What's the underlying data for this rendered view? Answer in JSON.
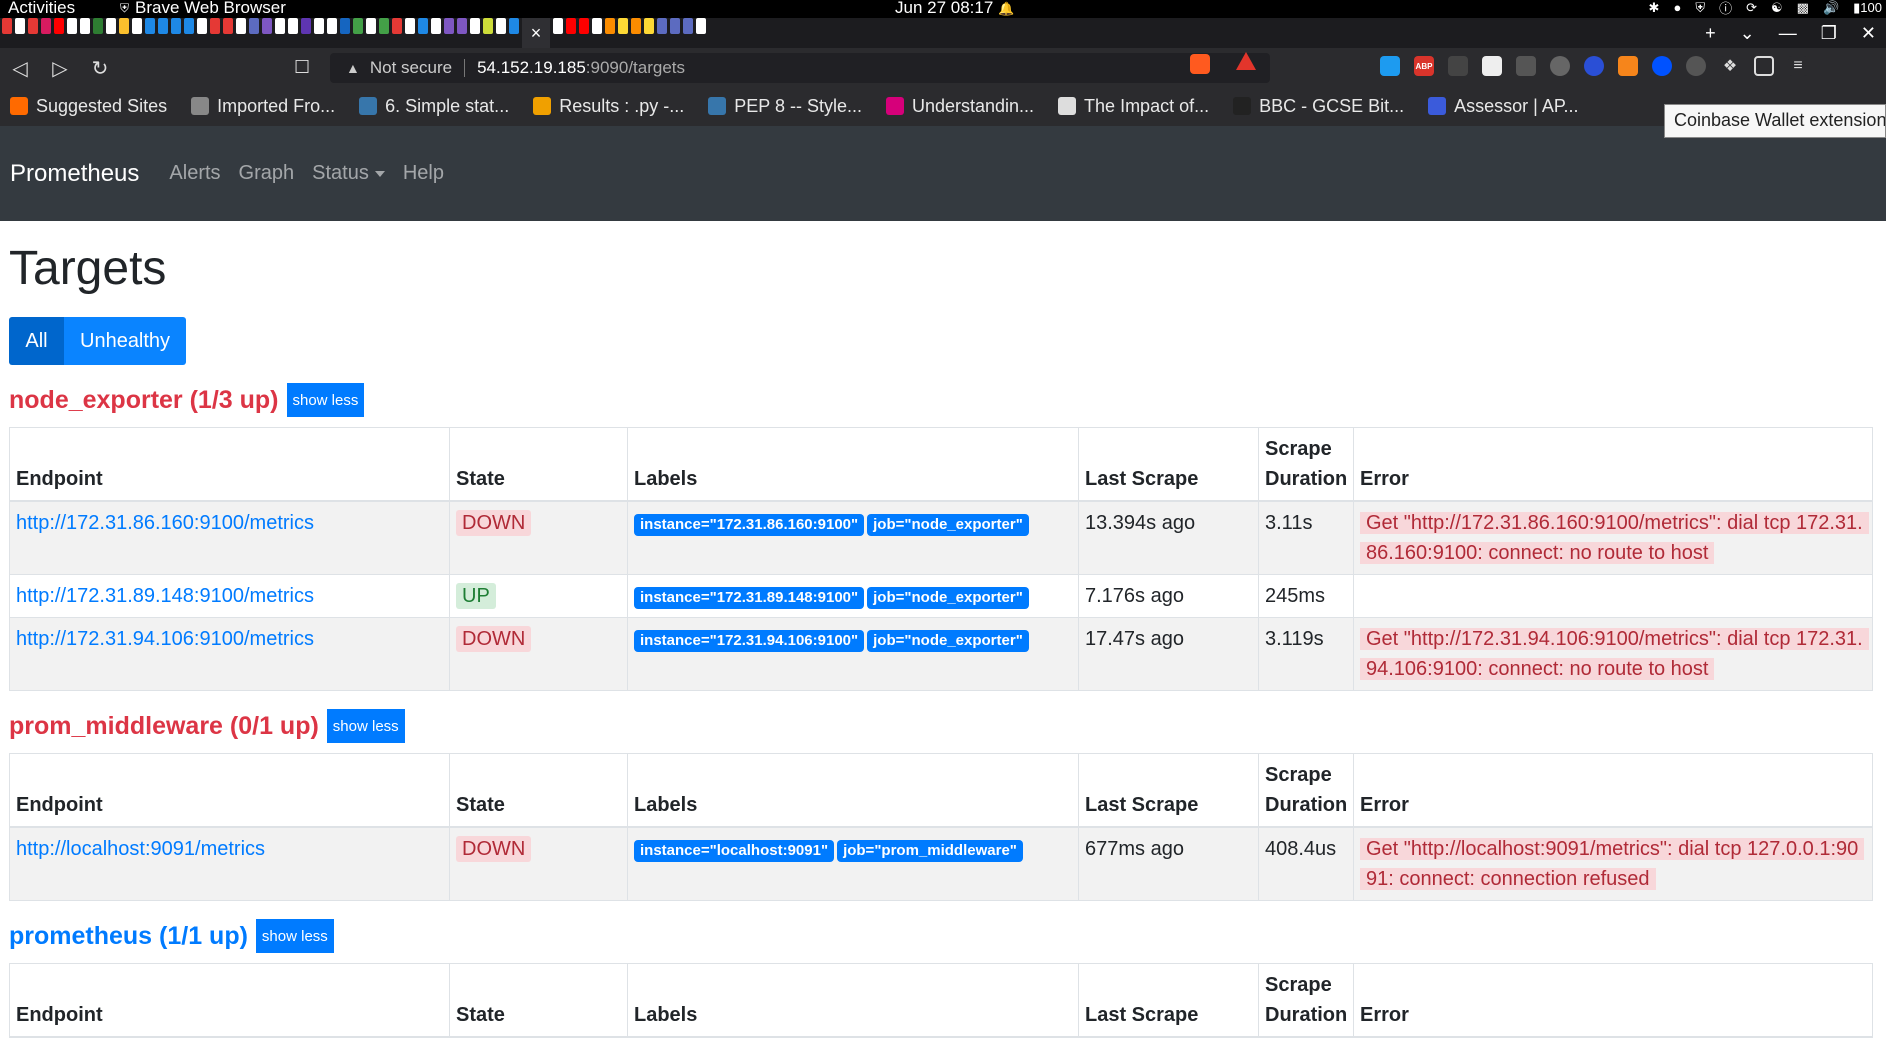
{
  "system": {
    "activities": "Activities",
    "app_name": "Brave Web Browser",
    "clock": "Jun 27  08:17",
    "battery": "100"
  },
  "browser": {
    "url_warning": "Not secure",
    "url_host": "54.152.19.185",
    "url_path": ":9090/targets",
    "bookmarks": [
      {
        "label": "Suggested Sites",
        "color": "#ff6a00"
      },
      {
        "label": "Imported Fro...",
        "color": "#888888"
      },
      {
        "label": "6. Simple stat...",
        "color": "#3776ab"
      },
      {
        "label": "Results : .py -...",
        "color": "#f0a000"
      },
      {
        "label": "PEP 8 -- Style...",
        "color": "#3776ab"
      },
      {
        "label": "Understandin...",
        "color": "#d6007a"
      },
      {
        "label": "The Impact of...",
        "color": "#dddddd"
      },
      {
        "label": "BBC - GCSE Bit...",
        "color": "#222222"
      },
      {
        "label": "Assessor | AP...",
        "color": "#3b5bdb"
      }
    ],
    "tooltip": "Coinbase Wallet extension"
  },
  "prom_nav": {
    "brand": "Prometheus",
    "alerts": "Alerts",
    "graph": "Graph",
    "status": "Status",
    "help": "Help"
  },
  "page": {
    "title": "Targets",
    "filter_all": "All",
    "filter_unhealthy": "Unhealthy"
  },
  "table_headers": {
    "endpoint": "Endpoint",
    "state": "State",
    "labels": "Labels",
    "last_scrape": "Last Scrape",
    "scrape_duration": "Scrape Duration",
    "error": "Error"
  },
  "groups": [
    {
      "title": "node_exporter (1/3 up)",
      "show_less": "show less",
      "rows": [
        {
          "endpoint": "http://172.31.86.160:9100/metrics",
          "state": "DOWN",
          "instance": "instance=\"172.31.86.160:9100\"",
          "job": "job=\"node_exporter\"",
          "last_scrape": "13.394s ago",
          "duration": "3.11s",
          "error": "Get \"http://172.31.86.160:9100/metrics\": dial tcp 172.31.86.160:9100: connect: no route to host"
        },
        {
          "endpoint": "http://172.31.89.148:9100/metrics",
          "state": "UP",
          "instance": "instance=\"172.31.89.148:9100\"",
          "job": "job=\"node_exporter\"",
          "last_scrape": "7.176s ago",
          "duration": "245ms",
          "error": ""
        },
        {
          "endpoint": "http://172.31.94.106:9100/metrics",
          "state": "DOWN",
          "instance": "instance=\"172.31.94.106:9100\"",
          "job": "job=\"node_exporter\"",
          "last_scrape": "17.47s ago",
          "duration": "3.119s",
          "error": "Get \"http://172.31.94.106:9100/metrics\": dial tcp 172.31.94.106:9100: connect: no route to host"
        }
      ]
    },
    {
      "title": "prom_middleware (0/1 up)",
      "show_less": "show less",
      "rows": [
        {
          "endpoint": "http://localhost:9091/metrics",
          "state": "DOWN",
          "instance": "instance=\"localhost:9091\"",
          "job": "job=\"prom_middleware\"",
          "last_scrape": "677ms ago",
          "duration": "408.4us",
          "error": "Get \"http://localhost:9091/metrics\": dial tcp 127.0.0.1:9091: connect: connection refused"
        }
      ]
    },
    {
      "title": "prometheus (1/1 up)",
      "show_less": "show less",
      "rows": []
    }
  ]
}
